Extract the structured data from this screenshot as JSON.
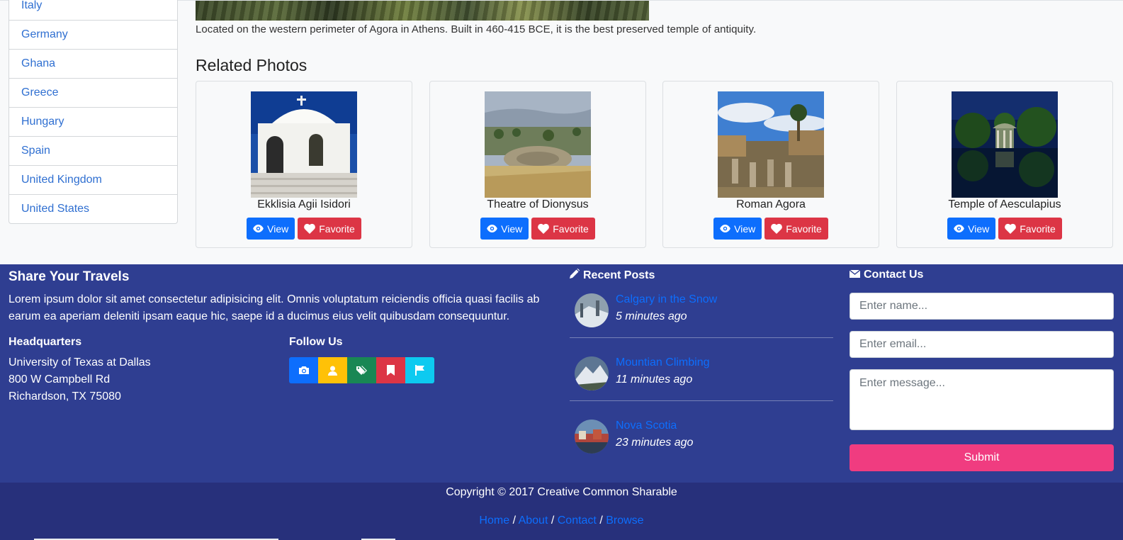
{
  "sidebar": {
    "countries": [
      "Italy",
      "Germany",
      "Ghana",
      "Greece",
      "Hungary",
      "Spain",
      "United Kingdom",
      "United States"
    ]
  },
  "photo": {
    "description": "Located on the western perimeter of Agora in Athens. Built in 460-415 BCE, it is the best preserved temple of antiquity."
  },
  "related": {
    "title": "Related Photos",
    "view_label": "View",
    "favorite_label": "Favorite",
    "items": [
      {
        "caption": "Ekklisia Agii Isidori"
      },
      {
        "caption": "Theatre of Dionysus"
      },
      {
        "caption": "Roman Agora"
      },
      {
        "caption": "Temple of Aesculapius"
      }
    ]
  },
  "footer": {
    "share_title": "Share Your Travels",
    "share_text": "Lorem ipsum dolor sit amet consectetur adipisicing elit. Omnis voluptatum reiciendis officia quasi facilis ab earum ea aperiam deleniti ipsam eaque hic, saepe id a ducimus eius velit quibusdam consequuntur.",
    "hq_title": "Headquarters",
    "hq_lines": [
      "University of Texas at Dallas",
      "800 W Campbell Rd",
      "Richardson, TX 75080"
    ],
    "follow_title": "Follow Us",
    "social_icons": [
      {
        "icon": "camera-icon",
        "color": "#0d6efd"
      },
      {
        "icon": "user-icon",
        "color": "#ffc107"
      },
      {
        "icon": "tag-icon",
        "color": "#198754"
      },
      {
        "icon": "bookmark-icon",
        "color": "#dc3545"
      },
      {
        "icon": "flag-icon",
        "color": "#0dcaf0"
      }
    ],
    "recent_title": "Recent Posts",
    "posts": [
      {
        "title": "Calgary in the Snow",
        "time": "5 minutes ago"
      },
      {
        "title": "Mountian Climbing",
        "time": "11 minutes ago"
      },
      {
        "title": "Nova Scotia",
        "time": "23 minutes ago"
      }
    ],
    "contact_title": "Contact Us",
    "name_placeholder": "Enter name...",
    "email_placeholder": "Enter email...",
    "message_placeholder": "Enter message...",
    "submit_label": "Submit"
  },
  "bottom": {
    "copyright": "Copyright © 2017 Creative Common Sharable",
    "links": [
      "Home",
      "About",
      "Contact",
      "Browse"
    ]
  },
  "colors": {
    "footer_bg": "#2f3e91",
    "bottom_bg": "#27307b",
    "view_btn": "#0d6efd",
    "favorite_btn": "#dc3545",
    "submit_btn": "#f03c80",
    "link": "#0d6efd"
  }
}
